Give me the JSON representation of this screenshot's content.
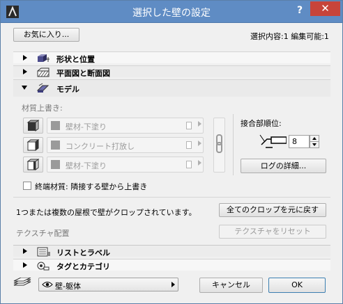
{
  "window": {
    "title": "選択した壁の設定",
    "help_label": "?",
    "close_label": "✕"
  },
  "top": {
    "favorites_label": "お気に入り...",
    "selection_info": "選択内容:1 編集可能:1"
  },
  "sections": {
    "shape": "形状と位置",
    "plan": "平面図と断面図",
    "model": "モデル",
    "list": "リストとラベル",
    "tag": "タグとカテゴリ"
  },
  "model": {
    "override_label": "材質上書き:",
    "materials": [
      "壁材-下塗り",
      "コンクリート打放し",
      "壁材-下塗り"
    ],
    "priority_label": "接合部順位:",
    "priority_value": "8",
    "log_button": "ログの詳細...",
    "end_material_label": "終端材質: 隣接する壁から上書き",
    "crop_message": "1つまたは複数の屋根で壁がクロップされています。",
    "reset_crop_button": "全てのクロップを元に戻す",
    "texture_label": "テクスチャ配置",
    "reset_texture_button": "テクスチャをリセット"
  },
  "footer": {
    "layer_name": "壁-躯体",
    "cancel_label": "キャンセル",
    "ok_label": "OK"
  },
  "colors": {
    "titlebar": "#5f8cc4",
    "close": "#c7443a"
  }
}
